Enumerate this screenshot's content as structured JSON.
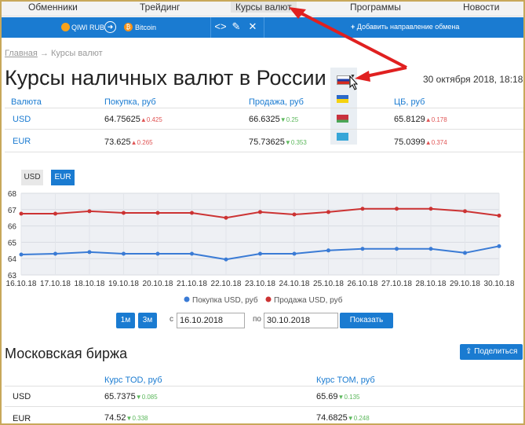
{
  "nav": {
    "items": [
      "Обменники",
      "Трейдинг",
      "Курсы валют",
      "Программы",
      "Новости"
    ]
  },
  "exchange_bar": {
    "from": "QIWI RUB",
    "to": "Bitcoin",
    "add_direction": "Добавить направление обмена"
  },
  "breadcrumb": {
    "home": "Главная",
    "separator": "→",
    "current": "Курсы валют"
  },
  "page": {
    "title": "Курсы наличных валют в России",
    "date": "30 октября 2018, 18:18"
  },
  "rates_table": {
    "headers": [
      "Валюта",
      "Покупка, руб",
      "Продажа, руб",
      "ЦБ, руб"
    ],
    "rows": [
      {
        "currency": "USD",
        "buy": "64.75625",
        "buy_delta": "0.425",
        "buy_dir": "up",
        "sell": "66.6325",
        "sell_delta": "0.25",
        "sell_dir": "down",
        "cb": "65.8129",
        "cb_delta": "0.178",
        "cb_dir": "up"
      },
      {
        "currency": "EUR",
        "buy": "73.625",
        "buy_delta": "0.265",
        "buy_dir": "up",
        "sell": "75.73625",
        "sell_delta": "0.353",
        "sell_dir": "down",
        "cb": "75.0399",
        "cb_delta": "0.374",
        "cb_dir": "up"
      }
    ]
  },
  "flags": [
    "russia-flag",
    "ukraine-flag",
    "belarus-flag",
    "kazakhstan-flag"
  ],
  "tabs": {
    "usd": "USD",
    "eur": "EUR",
    "active": "EUR"
  },
  "chart_data": {
    "type": "line",
    "x": [
      "16.10.18",
      "17.10.18",
      "18.10.18",
      "19.10.18",
      "20.10.18",
      "21.10.18",
      "22.10.18",
      "23.10.18",
      "24.10.18",
      "25.10.18",
      "26.10.18",
      "27.10.18",
      "28.10.18",
      "29.10.18",
      "30.10.18"
    ],
    "series": [
      {
        "name": "Покупка USD, руб",
        "color": "#3a7bd5",
        "values": [
          64.25,
          64.3,
          64.4,
          64.3,
          64.3,
          64.3,
          63.95,
          64.3,
          64.3,
          64.5,
          64.6,
          64.6,
          64.6,
          64.35,
          64.76
        ]
      },
      {
        "name": "Продажа USD, руб",
        "color": "#cc3333",
        "values": [
          66.75,
          66.75,
          66.9,
          66.8,
          66.8,
          66.8,
          66.5,
          66.85,
          66.7,
          66.85,
          67.05,
          67.05,
          67.05,
          66.9,
          66.63
        ]
      }
    ],
    "ylim": [
      63,
      68
    ],
    "yticks": [
      63,
      64,
      65,
      66,
      67,
      68
    ],
    "legend": "bottom",
    "grid": true
  },
  "period": {
    "btn_1m": "1м",
    "btn_3m": "3м",
    "from_label": "с",
    "from": "16.10.2018",
    "to_label": "по",
    "to": "30.10.2018",
    "show": "Показать"
  },
  "moex": {
    "title": "Московская биржа",
    "share": "Поделиться",
    "headers": [
      "Курс TOD, руб",
      "Курс TOM, руб"
    ],
    "rows": [
      {
        "currency": "USD",
        "tod": "65.7375",
        "tod_delta": "0.085",
        "tom": "65.69",
        "tom_delta": "0.135"
      },
      {
        "currency": "EUR",
        "tod": "74.52",
        "tod_delta": "0.338",
        "tom": "74.6825",
        "tom_delta": "0.248"
      }
    ]
  }
}
